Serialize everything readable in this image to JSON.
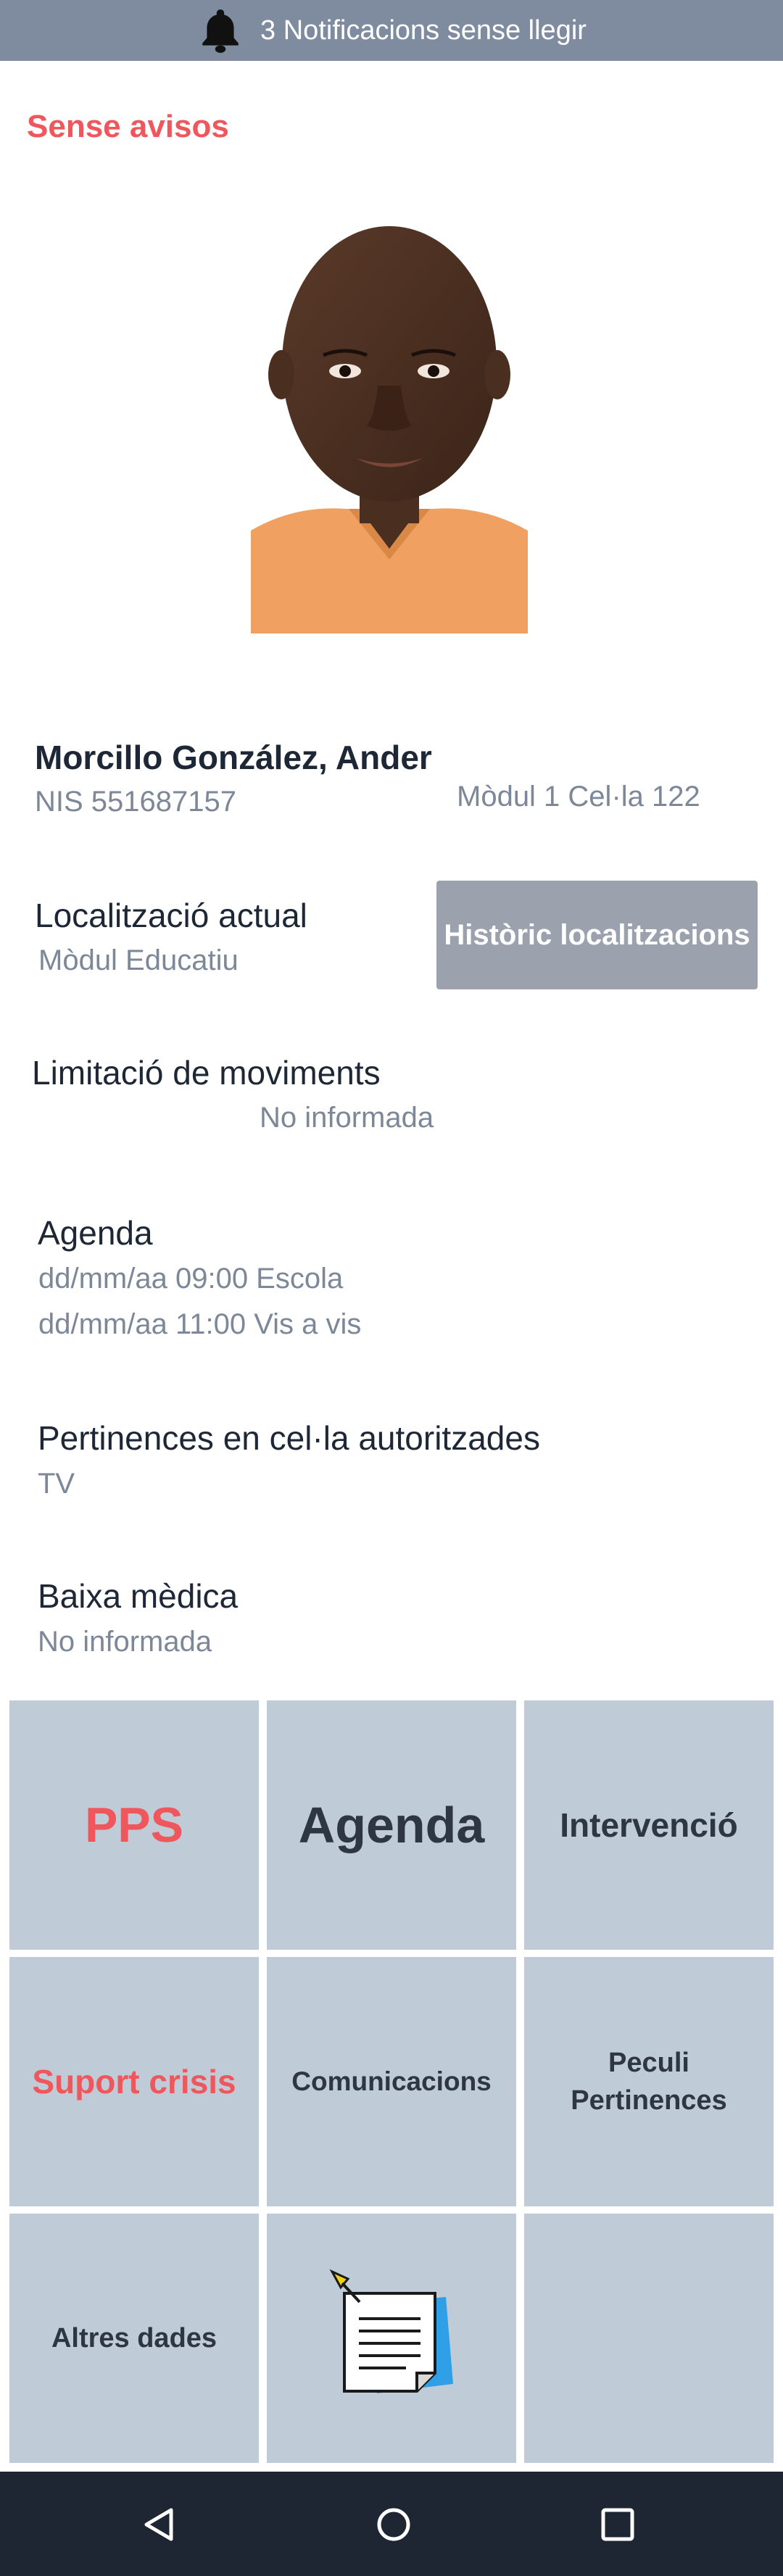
{
  "notification_bar": {
    "text": "3 Notificacions sense llegir",
    "icon": "bell-icon"
  },
  "alerts_title": "Sense avisos",
  "profile": {
    "name": "Morcillo González, Ander",
    "nis": "NIS 551687157",
    "cell": "Mòdul 1 Cel·la 122",
    "photo": "inmate-photo"
  },
  "location": {
    "label": "Localització actual",
    "value": "Mòdul Educatiu",
    "history_button": "Històric localitzacions"
  },
  "movement_limit": {
    "label": "Limitació de moviments",
    "value": "No informada"
  },
  "agenda": {
    "label": "Agenda",
    "items": [
      "dd/mm/aa 09:00 Escola",
      "dd/mm/aa 11:00 Vis a vis"
    ]
  },
  "belongings": {
    "label": "Pertinences en cel·la autoritzades",
    "value": "TV"
  },
  "medical_leave": {
    "label": "Baixa mèdica",
    "value": "No informada"
  },
  "grid": {
    "pps": "PPS",
    "agenda": "Agenda",
    "intervencio": "Intervenció",
    "suport_crisis": "Suport crisis",
    "comunicacions": "Comunicacions",
    "peculi_line1": "Peculi",
    "peculi_line2": "Pertinences",
    "altres_dades": "Altres dades",
    "notes_icon": "notepad-icon"
  },
  "nav": {
    "back": "back-icon",
    "home": "home-icon",
    "recents": "recents-icon"
  },
  "colors": {
    "accent_red": "#f0575c",
    "tile_bg": "#c0cbd8",
    "notif_bg": "#7f8ca0",
    "nav_bg": "#1e2633"
  }
}
